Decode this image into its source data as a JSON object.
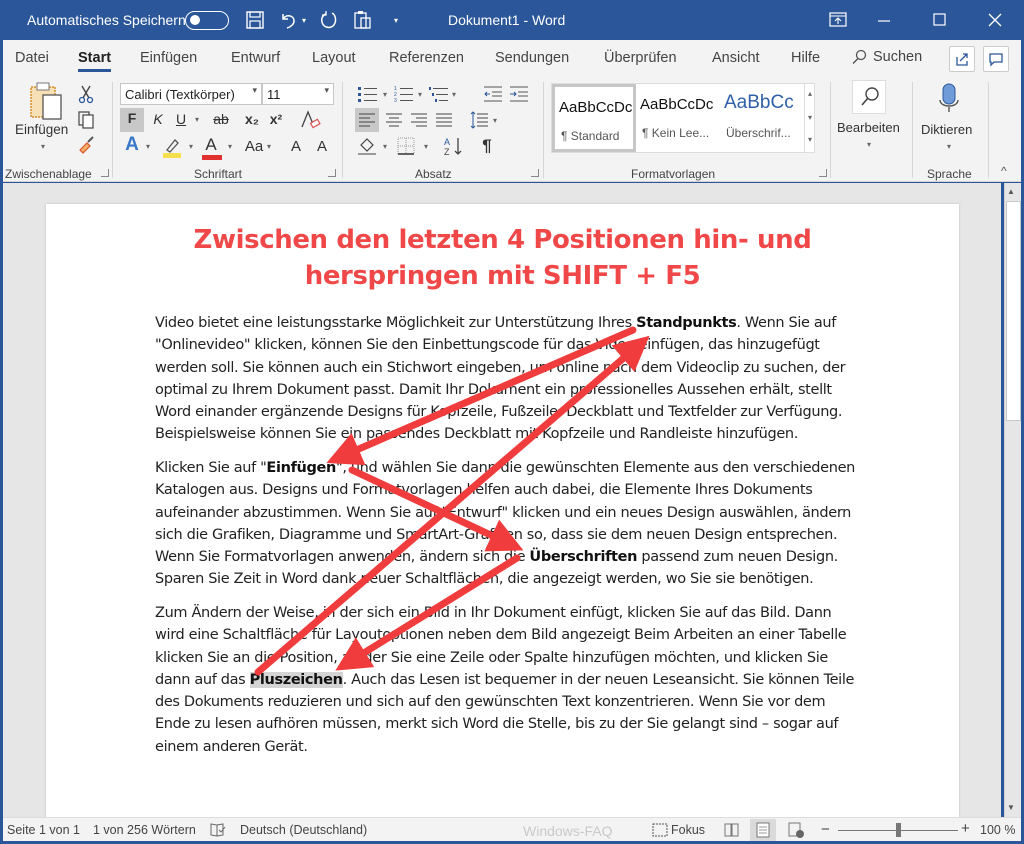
{
  "titlebar": {
    "autosave_label": "Automatisches Speichern",
    "autosave_state": "off",
    "document_title": "Dokument1  -  Word",
    "icons": [
      "save-icon",
      "undo-icon",
      "undo-dropdown-icon",
      "redo-icon",
      "paste-options-icon",
      "customize-quick-access-icon"
    ],
    "window_controls": [
      "ribbon-display-options-icon",
      "minimize-icon",
      "maximize-icon",
      "close-icon"
    ]
  },
  "tabs": [
    {
      "label": "Datei"
    },
    {
      "label": "Start",
      "active": true
    },
    {
      "label": "Einfügen"
    },
    {
      "label": "Entwurf"
    },
    {
      "label": "Layout"
    },
    {
      "label": "Referenzen"
    },
    {
      "label": "Sendungen"
    },
    {
      "label": "Überprüfen"
    },
    {
      "label": "Ansicht"
    },
    {
      "label": "Hilfe"
    }
  ],
  "search_label": "Suchen",
  "ribbon": {
    "clipboard": {
      "paste_label": "Einfügen",
      "group_label": "Zwischenablage"
    },
    "font": {
      "font_name": "Calibri (Textkörper)",
      "font_size": "11",
      "bold_label": "F",
      "italic_label": "K",
      "underline_label": "U",
      "strike_label": "ab",
      "subscript_label": "x₂",
      "superscript_label": "x²",
      "text_effects_label": "A",
      "highlight_color": "#f4e04d",
      "font_color_label": "A",
      "font_color": "#e03030",
      "change_case_label": "Aa",
      "grow_label": "A",
      "shrink_label": "A",
      "group_label": "Schriftart"
    },
    "paragraph": {
      "group_label": "Absatz",
      "pilcrow": "¶"
    },
    "styles": {
      "items": [
        {
          "preview": "AaBbCcDc",
          "name": "¶ Standard",
          "selected": true
        },
        {
          "preview": "AaBbCcDc",
          "name": "¶ Kein Lee..."
        },
        {
          "preview": "AaBbCc",
          "name": "Überschrif..."
        }
      ],
      "group_label": "Formatvorlagen"
    },
    "editing": {
      "label": "Bearbeiten"
    },
    "voice": {
      "label": "Diktieren",
      "group_label": "Sprache"
    }
  },
  "document": {
    "heading_line1": "Zwischen den letzten 4 Positionen hin- und",
    "heading_line2": "herspringen mit SHIFT + F5",
    "heading_color": "#f04848",
    "p1": {
      "before": "Video bietet eine leistungsstarke Möglichkeit zur Unterstützung Ihres ",
      "bold": "Standpunkts",
      "after": ". Wenn Sie auf \"Onlinevideo\" klicken, können Sie den Einbettungscode für das Video einfügen, das hinzugefügt werden soll. Sie können auch ein Stichwort eingeben, um online nach dem Videoclip zu suchen, der optimal zu Ihrem Dokument passt. Damit Ihr Dokument ein professionelles Aussehen erhält, stellt Word einander ergänzende Designs für Kopfzeile, Fußzeile, Deckblatt und Textfelder zur Verfügung. Beispielsweise können Sie ein passendes Deckblatt mit Kopfzeile und Randleiste hinzufügen."
    },
    "p2": {
      "before": "Klicken Sie auf \"",
      "bold1": "Einfügen",
      "middle": "\", und wählen Sie dann die gewünschten Elemente aus den verschiedenen Katalogen aus. Designs und Formatvorlagen helfen auch dabei, die Elemente Ihres Dokuments aufeinander abzustimmen. Wenn Sie auf \"Entwurf\" klicken und ein neues Design auswählen, ändern sich die Grafiken, Diagramme und SmartArt-Grafiken so, dass sie dem neuen Design entsprechen. Wenn Sie Formatvorlagen anwenden, ändern sich die ",
      "bold2": "Überschriften",
      "after": " passend zum neuen Design. Sparen Sie Zeit in Word dank neuer Schaltflächen, die angezeigt werden, wo Sie sie benötigen."
    },
    "p3": {
      "before": "Zum Ändern der Weise, in der sich ein Bild in Ihr Dokument einfügt, klicken Sie auf das Bild. Dann wird eine Schaltfläche für Layoutoptionen neben dem Bild angezeigt Beim Arbeiten an einer Tabelle klicken Sie an die Position, an der Sie eine Zeile oder Spalte hinzufügen möchten, und klicken Sie dann auf das ",
      "bold_highlight": "Pluszeichen",
      "after": ". Auch das Lesen ist bequemer in der neuen Leseansicht. Sie können Teile des Dokuments reduzieren und sich auf den gewünschten Text konzentrieren. Wenn Sie vor dem Ende zu lesen aufhören müssen, merkt sich Word die Stelle, bis zu der Sie gelangt sind – sogar auf einem anderen Gerät."
    },
    "annotation_arrows": {
      "color": "#f03c3c",
      "sequence": [
        "Standpunkts",
        "Einfügen",
        "Überschriften",
        "Pluszeichen",
        "Standpunkts"
      ]
    }
  },
  "statusbar": {
    "page": "Seite 1 von 1",
    "words": "1 von 256 Wörtern",
    "language": "Deutsch (Deutschland)",
    "focus_label": "Fokus",
    "zoom_minus": "−",
    "zoom_plus": "+",
    "zoom_level": "100 %",
    "zoom_fraction": 0.5,
    "watermark": "Windows-FAQ"
  }
}
